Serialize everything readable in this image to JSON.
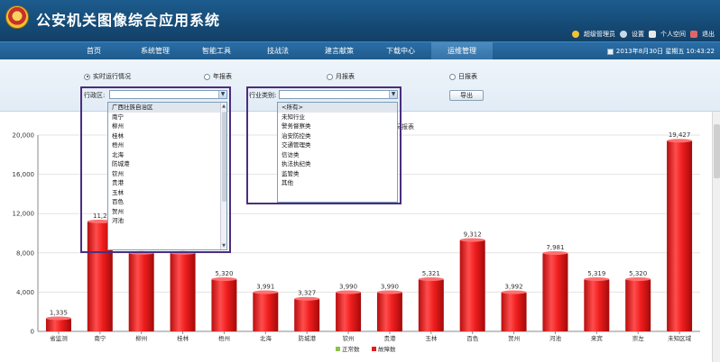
{
  "header": {
    "title": "公安机关图像综合应用系统",
    "user_name": "超级管理员",
    "settings_label": "设置",
    "personal_space_label": "个人空间",
    "logout_label": "退出"
  },
  "nav": {
    "items": [
      "首页",
      "系统管理",
      "智能工具",
      "技战法",
      "建言献策",
      "下载中心",
      "运维管理"
    ],
    "active_index": 6,
    "datetime": "2013年8月30日 星期五 10:43:22"
  },
  "filters": {
    "radios": [
      {
        "label": "实时运行情况",
        "checked": true
      },
      {
        "label": "年报表",
        "checked": false
      },
      {
        "label": "月报表",
        "checked": false
      },
      {
        "label": "日报表",
        "checked": false
      }
    ],
    "region_label": "行政区:",
    "region_value": "",
    "industry_label": "行业类别:",
    "industry_value": "",
    "export_label": "导出"
  },
  "region_dropdown": {
    "items": [
      "广西壮族自治区",
      "南宁",
      "柳州",
      "桂林",
      "梧州",
      "北海",
      "防城港",
      "钦州",
      "贵港",
      "玉林",
      "百色",
      "贺州",
      "河池"
    ],
    "selected_index": 0
  },
  "industry_dropdown": {
    "items": [
      "<所有>",
      "未知行业",
      "警务督察类",
      "治安防控类",
      "交通管理类",
      "信访类",
      "执法执纪类",
      "监管类",
      "其他"
    ],
    "selected_index": 0
  },
  "chart_title_fragment": "况报表",
  "chart_data": {
    "type": "bar",
    "categories": [
      "省监测",
      "南宁",
      "柳州",
      "桂林",
      "梧州",
      "北海",
      "防城港",
      "钦州",
      "贵港",
      "玉林",
      "百色",
      "贺州",
      "河池",
      "来宾",
      "崇左",
      "未知区域"
    ],
    "series": [
      {
        "name": "正常数",
        "values": [
          0,
          0,
          0,
          0,
          0,
          0,
          0,
          0,
          0,
          0,
          0,
          0,
          0,
          0,
          0,
          0
        ],
        "color": "#8bc34a"
      },
      {
        "name": "故障数",
        "values": [
          1335,
          11200,
          8000,
          8000,
          5320,
          3991,
          3327,
          3990,
          3990,
          5321,
          9312,
          3992,
          7981,
          5319,
          5320,
          19427
        ],
        "color": "#e31b1b"
      }
    ],
    "data_labels": [
      "1,335",
      "11,2",
      "",
      "",
      "5,320",
      "3,991",
      "3,327",
      "3,990",
      "3,990",
      "5,321",
      "9,312",
      "3,992",
      "7,981",
      "5,319",
      "5,320",
      "19,427"
    ],
    "y_ticks": [
      "20,000",
      "16,000",
      "12,000",
      "8,000",
      "4,000",
      "0"
    ],
    "ylim": [
      0,
      20000
    ],
    "grid": true,
    "legend_position": "bottom-center"
  }
}
